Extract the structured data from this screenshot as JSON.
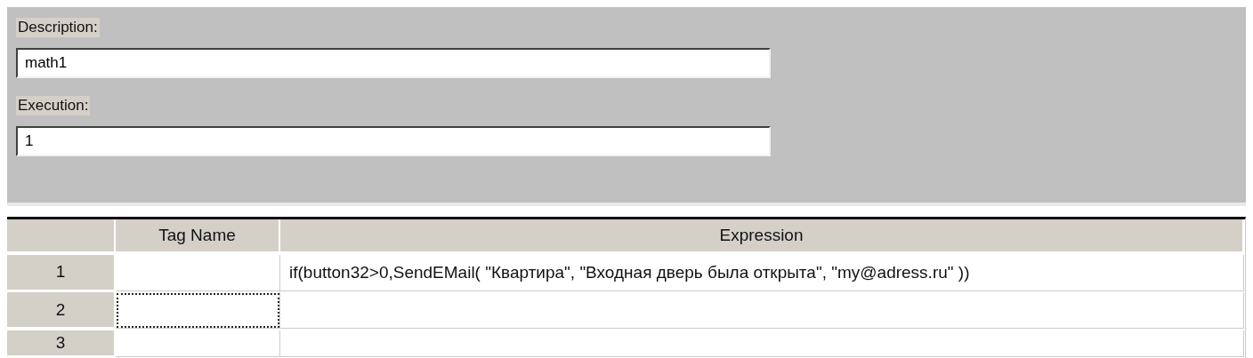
{
  "form": {
    "fields": [
      {
        "label": "Description:",
        "value": "math1"
      },
      {
        "label": "Execution:",
        "value": "1"
      }
    ]
  },
  "table": {
    "columns": [
      "Tag Name",
      "Expression"
    ],
    "rows": [
      {
        "header": "1",
        "cells": [
          "",
          "if(button32>0,SendEMail( \"Квартира\", \"Входная дверь была открыта\", \"my@adress.ru\" ))"
        ],
        "focused_cell": false
      },
      {
        "header": "2",
        "cells": [
          "",
          ""
        ],
        "focused_cell": true
      },
      {
        "header": "3",
        "cells": [
          "",
          ""
        ],
        "focused_cell": false
      }
    ]
  }
}
